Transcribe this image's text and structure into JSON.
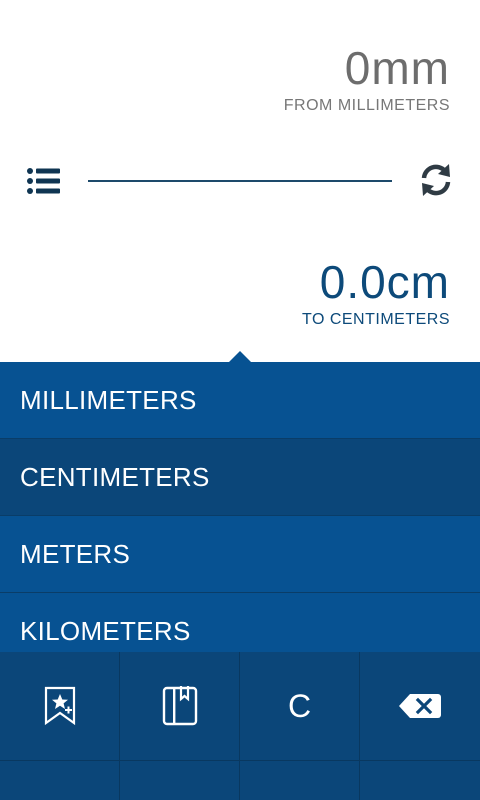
{
  "converter": {
    "from_value": "0mm",
    "from_label": "FROM MILLIMETERS",
    "to_value": "0.0cm",
    "to_label": "TO CENTIMETERS"
  },
  "toolbar": {
    "list_icon": "list-icon",
    "swap_icon": "swap-icon"
  },
  "units": [
    {
      "label": "MILLIMETERS",
      "selected": false
    },
    {
      "label": "CENTIMETERS",
      "selected": true
    },
    {
      "label": "METERS",
      "selected": false
    },
    {
      "label": "KILOMETERS",
      "selected": false
    }
  ],
  "keypad": {
    "favorite_add_icon": "bookmark-star-plus-icon",
    "notebook_icon": "notebook-icon",
    "clear_label": "C",
    "backspace_icon": "backspace-icon"
  },
  "colors": {
    "accent": "#075292",
    "selected": "#0b4679",
    "text_primary": "#0d4a7a",
    "text_muted": "#6d6d6d"
  }
}
